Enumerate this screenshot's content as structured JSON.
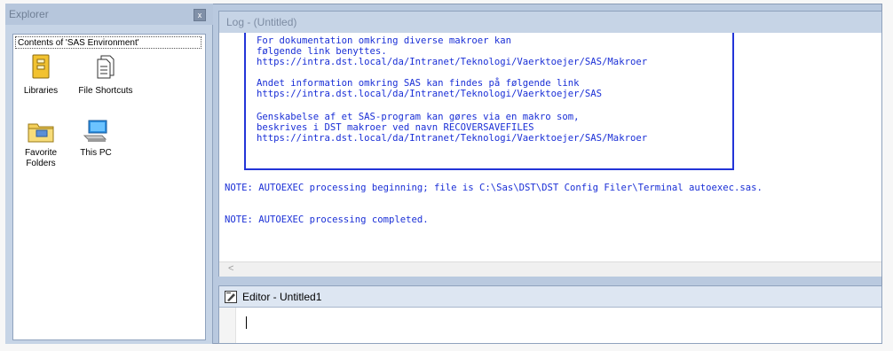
{
  "explorer": {
    "title": "Explorer",
    "close_glyph": "x",
    "contents_label": "Contents of 'SAS Environment'",
    "items": [
      {
        "label": "Libraries",
        "icon": "libraries-icon"
      },
      {
        "label": "File Shortcuts",
        "icon": "file-shortcuts-icon"
      },
      {
        "label": "Favorite Folders",
        "icon": "favorite-folders-icon"
      },
      {
        "label": "This PC",
        "icon": "this-pc-icon"
      }
    ]
  },
  "log": {
    "title": "Log - (Untitled)",
    "box_lines": [
      "For dokumentation omkring diverse makroer kan",
      "følgende link benyttes.",
      "https://intra.dst.local/da/Intranet/Teknologi/Vaerktoejer/SAS/Makroer",
      "",
      "Andet information omkring SAS kan findes på følgende link",
      "https://intra.dst.local/da/Intranet/Teknologi/Vaerktoejer/SAS",
      "",
      "Genskabelse af et SAS-program kan gøres via en makro som,",
      "beskrives i DST makroer ved navn RECOVERSAVEFILES",
      "https://intra.dst.local/da/Intranet/Teknologi/Vaerktoejer/SAS/Makroer"
    ],
    "note_1": "NOTE: AUTOEXEC processing beginning; file is C:\\Sas\\DST\\DST Config Filer\\Terminal autoexec.sas.",
    "note_2": "NOTE: AUTOEXEC processing completed.",
    "scroll_left_glyph": "<"
  },
  "editor": {
    "title": "Editor - Untitled1",
    "content": ""
  },
  "colors": {
    "log_text": "#1a2fd6",
    "frame": "#b9c9df"
  }
}
